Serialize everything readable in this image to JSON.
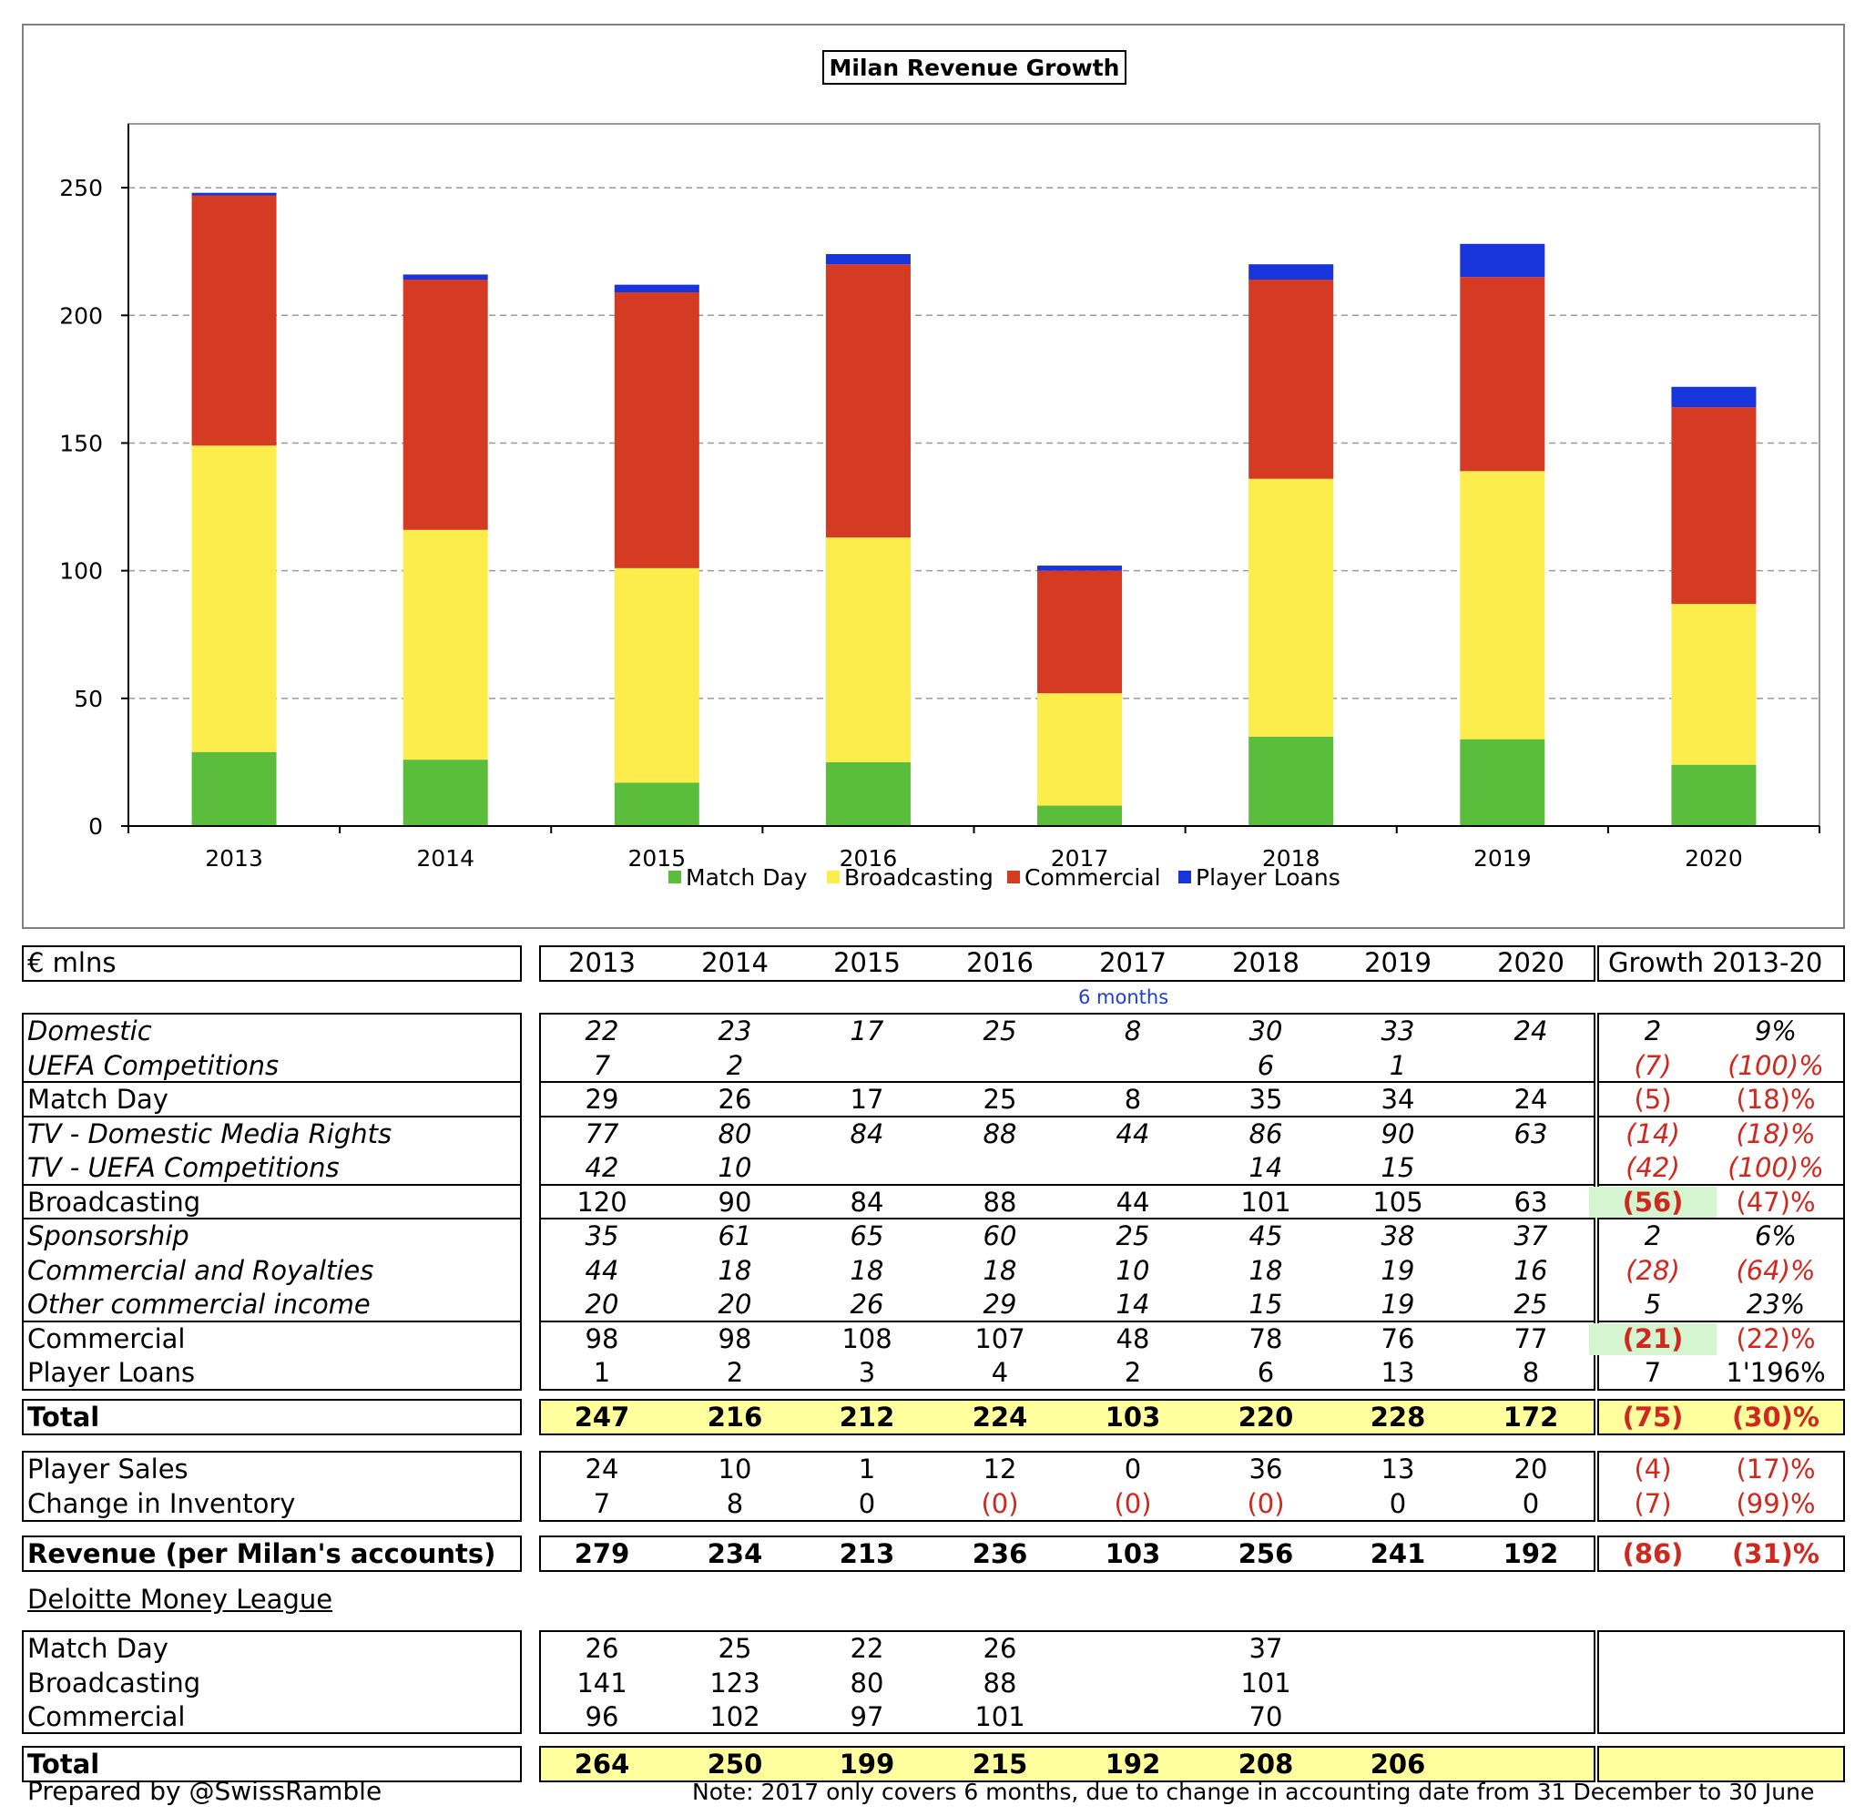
{
  "chart_data": {
    "type": "bar",
    "stacked": true,
    "title": "Milan Revenue Growth",
    "categories": [
      "2013",
      "2014",
      "2015",
      "2016",
      "2017",
      "2018",
      "2019",
      "2020"
    ],
    "series": [
      {
        "name": "Match Day",
        "color": "#5bbd3c",
        "values": [
          29,
          26,
          17,
          25,
          8,
          35,
          34,
          24
        ]
      },
      {
        "name": "Broadcasting",
        "color": "#fced4c",
        "values": [
          120,
          90,
          84,
          88,
          44,
          101,
          105,
          63
        ]
      },
      {
        "name": "Commercial",
        "color": "#d43b22",
        "values": [
          98,
          98,
          108,
          107,
          48,
          78,
          76,
          77
        ]
      },
      {
        "name": "Player Loans",
        "color": "#1835dc",
        "values": [
          1,
          2,
          3,
          4,
          2,
          6,
          13,
          8
        ]
      }
    ],
    "ylim": [
      0,
      275
    ],
    "yticks": [
      0,
      50,
      100,
      150,
      200,
      250
    ],
    "grid": true,
    "legend": "bottom"
  },
  "table": {
    "unit_label": "€ mlns",
    "years": [
      "2013",
      "2014",
      "2015",
      "2016",
      "2017",
      "2018",
      "2019",
      "2020"
    ],
    "growth_header": "Growth 2013-20",
    "note_2017": "6 months",
    "groups": [
      {
        "rows": [
          {
            "label": "Domestic",
            "italic": true,
            "vals": [
              "22",
              "23",
              "17",
              "25",
              "8",
              "30",
              "33",
              "24"
            ],
            "g1": "2",
            "g2": "9%"
          },
          {
            "label": "UEFA Competitions",
            "italic": true,
            "vals": [
              "7",
              "2",
              "",
              "",
              "",
              "6",
              "1",
              ""
            ],
            "g1": "(7)",
            "g2": "(100)%",
            "red": true
          }
        ]
      },
      {
        "rows": [
          {
            "label": "Match Day",
            "vals": [
              "29",
              "26",
              "17",
              "25",
              "8",
              "35",
              "34",
              "24"
            ],
            "g1": "(5)",
            "g2": "(18)%",
            "red": true
          }
        ]
      },
      {
        "rows": [
          {
            "label": "TV - Domestic Media Rights",
            "italic": true,
            "vals": [
              "77",
              "80",
              "84",
              "88",
              "44",
              "86",
              "90",
              "63"
            ],
            "g1": "(14)",
            "g2": "(18)%",
            "red": true
          },
          {
            "label": "TV - UEFA Competitions",
            "italic": true,
            "vals": [
              "42",
              "10",
              "",
              "",
              "",
              "14",
              "15",
              ""
            ],
            "g1": "(42)",
            "g2": "(100)%",
            "red": true
          }
        ]
      },
      {
        "rows": [
          {
            "label": "Broadcasting",
            "vals": [
              "120",
              "90",
              "84",
              "88",
              "44",
              "101",
              "105",
              "63"
            ],
            "g1": "(56)",
            "g2": "(47)%",
            "red": true,
            "g1bold": true,
            "g1green": true
          }
        ]
      },
      {
        "rows": [
          {
            "label": "Sponsorship",
            "italic": true,
            "vals": [
              "35",
              "61",
              "65",
              "60",
              "25",
              "45",
              "38",
              "37"
            ],
            "g1": "2",
            "g2": "6%"
          },
          {
            "label": "Commercial and Royalties",
            "italic": true,
            "vals": [
              "44",
              "18",
              "18",
              "18",
              "10",
              "18",
              "19",
              "16"
            ],
            "g1": "(28)",
            "g2": "(64)%",
            "red": true
          },
          {
            "label": "Other commercial income",
            "italic": true,
            "vals": [
              "20",
              "20",
              "26",
              "29",
              "14",
              "15",
              "19",
              "25"
            ],
            "g1": "5",
            "g2": "23%"
          }
        ]
      },
      {
        "rows": [
          {
            "label": "Commercial",
            "vals": [
              "98",
              "98",
              "108",
              "107",
              "48",
              "78",
              "76",
              "77"
            ],
            "g1": "(21)",
            "g2": "(22)%",
            "red": true,
            "g1bold": true,
            "g1green": true
          },
          {
            "label": "Player Loans",
            "vals": [
              "1",
              "2",
              "3",
              "4",
              "2",
              "6",
              "13",
              "8"
            ],
            "g1": "7",
            "g2": "1'196%"
          }
        ]
      }
    ],
    "total": {
      "label": "Total",
      "vals": [
        "247",
        "216",
        "212",
        "224",
        "103",
        "220",
        "228",
        "172"
      ],
      "g1": "(75)",
      "g2": "(30)%"
    },
    "sales": [
      {
        "label": "Player Sales",
        "vals": [
          "24",
          "10",
          "1",
          "12",
          "0",
          "36",
          "13",
          "20"
        ],
        "g1": "(4)",
        "g2": "(17)%"
      },
      {
        "label": "Change in Inventory",
        "vals": [
          "7",
          "8",
          "0",
          "(0)",
          "(0)",
          "(0)",
          "0",
          "0"
        ],
        "redvals": [
          false,
          false,
          false,
          true,
          true,
          true,
          false,
          false
        ],
        "g1": "(7)",
        "g2": "(99)%"
      }
    ],
    "revenue": {
      "label": "Revenue (per Milan's accounts)",
      "vals": [
        "279",
        "234",
        "213",
        "236",
        "103",
        "256",
        "241",
        "192"
      ],
      "g1": "(86)",
      "g2": "(31)%"
    },
    "deloitte_header": "Deloitte Money League",
    "deloitte": [
      {
        "label": "Match Day",
        "vals": [
          "26",
          "25",
          "22",
          "26",
          "",
          "37",
          "",
          ""
        ]
      },
      {
        "label": "Broadcasting",
        "vals": [
          "141",
          "123",
          "80",
          "88",
          "",
          "101",
          "",
          ""
        ]
      },
      {
        "label": "Commercial",
        "vals": [
          "96",
          "102",
          "97",
          "101",
          "",
          "70",
          "",
          ""
        ]
      }
    ],
    "deloitte_total": {
      "label": "Total",
      "vals": [
        "264",
        "250",
        "199",
        "215",
        "192",
        "208",
        "206",
        ""
      ]
    }
  },
  "footer": {
    "prepared_by": "Prepared by @SwissRamble",
    "note": "Note: 2017 only covers 6 months, due to change in accounting date from 31 December to 30 June"
  }
}
